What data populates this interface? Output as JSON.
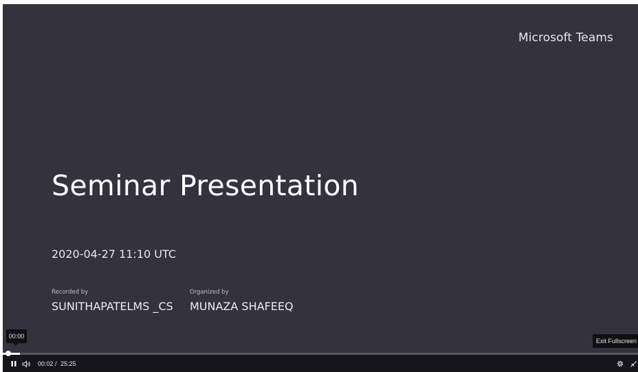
{
  "player": {
    "brand": "Microsoft Teams",
    "title": "Seminar Presentation",
    "datetime": "2020-04-27 11:10 UTC",
    "recorded_by_label": "Recorded by",
    "recorded_by_value": "SUNITHAPATELMS _CS",
    "organized_by_label": "Organized by",
    "organized_by_value": "MUNAZA SHAFEEQ",
    "hover_time": "00:00",
    "exit_tooltip": "Exit Fullscreen",
    "current_time": "00:02",
    "time_separator": "/",
    "duration": "25:25",
    "progress_fraction": 0.0013
  },
  "colors": {
    "background": "#34323c",
    "control_bar": "#16151a",
    "text": "#ffffff"
  },
  "icons": {
    "pause": "pause-icon",
    "volume": "volume-icon",
    "settings": "gear-icon",
    "fullscreen": "exit-fullscreen-icon"
  }
}
